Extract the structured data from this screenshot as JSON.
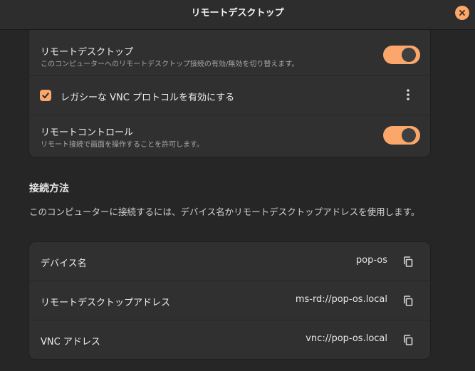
{
  "window": {
    "title": "リモートデスクトップ"
  },
  "remote_desktop": {
    "title": "リモートデスクトップ",
    "subtitle": "このコンピューターへのリモートデスクトップ接続の有効/無効を切り替えます。",
    "enabled": true
  },
  "legacy_vnc": {
    "label": "レガシーな VNC プロトコルを有効にする",
    "checked": true
  },
  "remote_control": {
    "title": "リモートコントロール",
    "subtitle": "リモート接続で画面を操作することを許可します。",
    "enabled": true
  },
  "connection": {
    "heading": "接続方法",
    "description": "このコンピューターに接続するには、デバイス名かリモートデスクトップアドレスを使用します。",
    "rows": [
      {
        "label": "デバイス名",
        "value": "pop-os"
      },
      {
        "label": "リモートデスクトップアドレス",
        "value": "ms-rd://pop-os.local"
      },
      {
        "label": "VNC アドレス",
        "value": "vnc://pop-os.local"
      }
    ]
  },
  "icons": {
    "close": "close-icon",
    "check": "checkmark-icon",
    "menu": "vertical-ellipsis-icon",
    "copy": "copy-icon"
  },
  "colors": {
    "accent": "#fba66a",
    "background": "#262626",
    "card": "#303030",
    "header": "#2d2d2d"
  }
}
